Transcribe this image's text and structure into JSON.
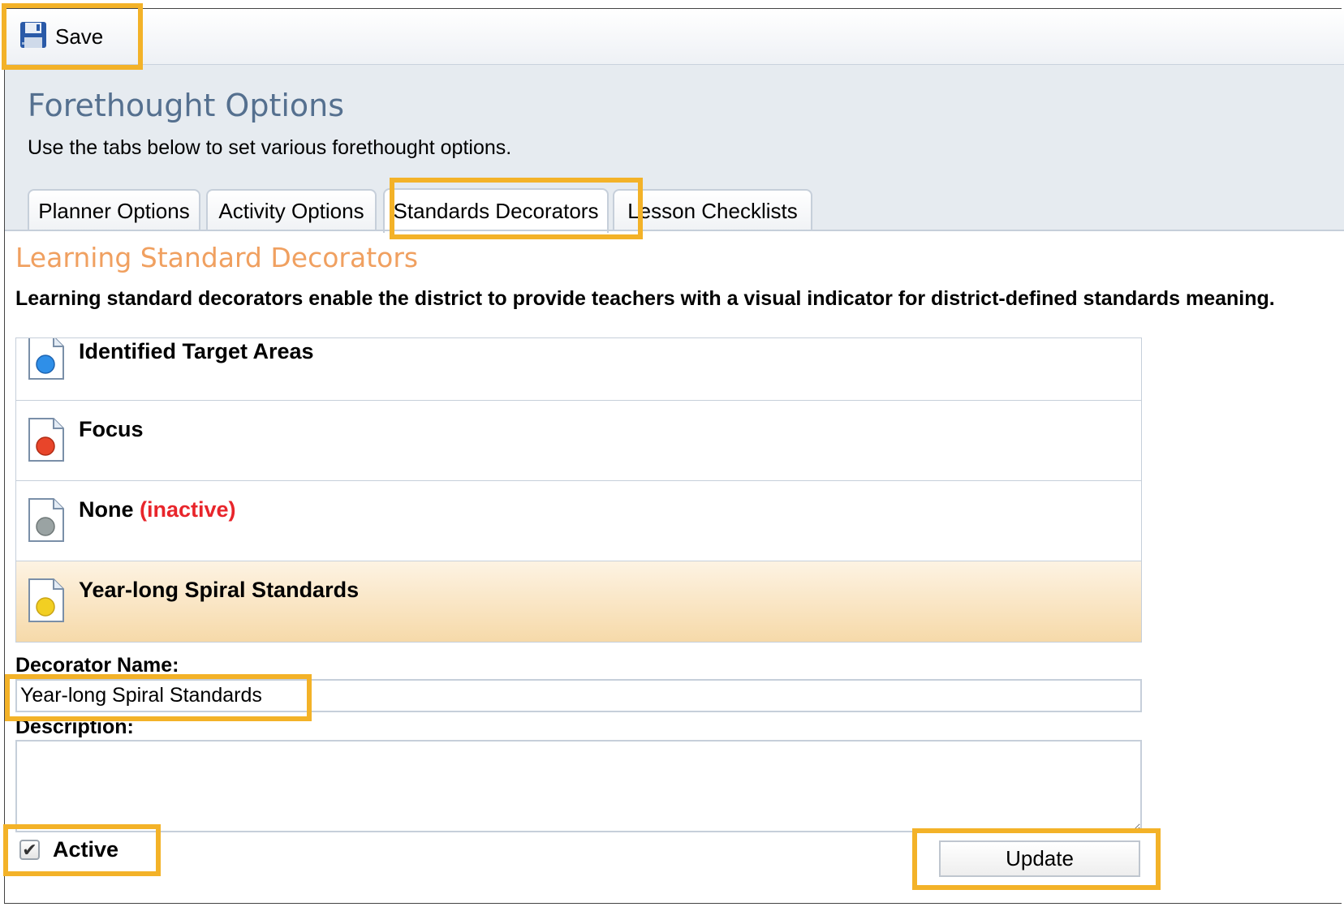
{
  "toolbar": {
    "save_label": "Save",
    "save_icon": "floppy-disk-icon"
  },
  "header": {
    "title": "Forethought Options",
    "subtitle": "Use the tabs below to set various forethought options."
  },
  "tabs": [
    {
      "label": "Planner Options",
      "active": false
    },
    {
      "label": "Activity Options",
      "active": false
    },
    {
      "label": "Standards Decorators",
      "active": true
    },
    {
      "label": "Lesson Checklists",
      "active": false
    }
  ],
  "section": {
    "title": "Learning Standard Decorators",
    "description": "Learning standard decorators enable the district to provide teachers with a visual indicator for district-defined standards meaning."
  },
  "decorators": [
    {
      "name": "Identified Target Areas",
      "color": "#2f8fe8",
      "icon": "blue-dot-document-icon"
    },
    {
      "name": "Focus",
      "color": "#e8452a",
      "icon": "red-dot-document-icon"
    },
    {
      "name": "None",
      "status": "(inactive)",
      "color": "#9aa3a3",
      "icon": "gray-dot-document-icon"
    },
    {
      "name": "Year-long Spiral Standards",
      "color": "#f2cf22",
      "icon": "yellow-dot-document-icon",
      "selected": true
    }
  ],
  "form": {
    "name_label": "Decorator Name:",
    "name_value": "Year-long Spiral Standards",
    "description_label": "Description:",
    "description_value": "",
    "active_label": "Active",
    "active_checked": true,
    "update_label": "Update"
  },
  "colors": {
    "highlight": "#f3b228",
    "title_blue": "#55708f",
    "section_orange": "#f0a060",
    "inactive_red": "#e8252b"
  }
}
